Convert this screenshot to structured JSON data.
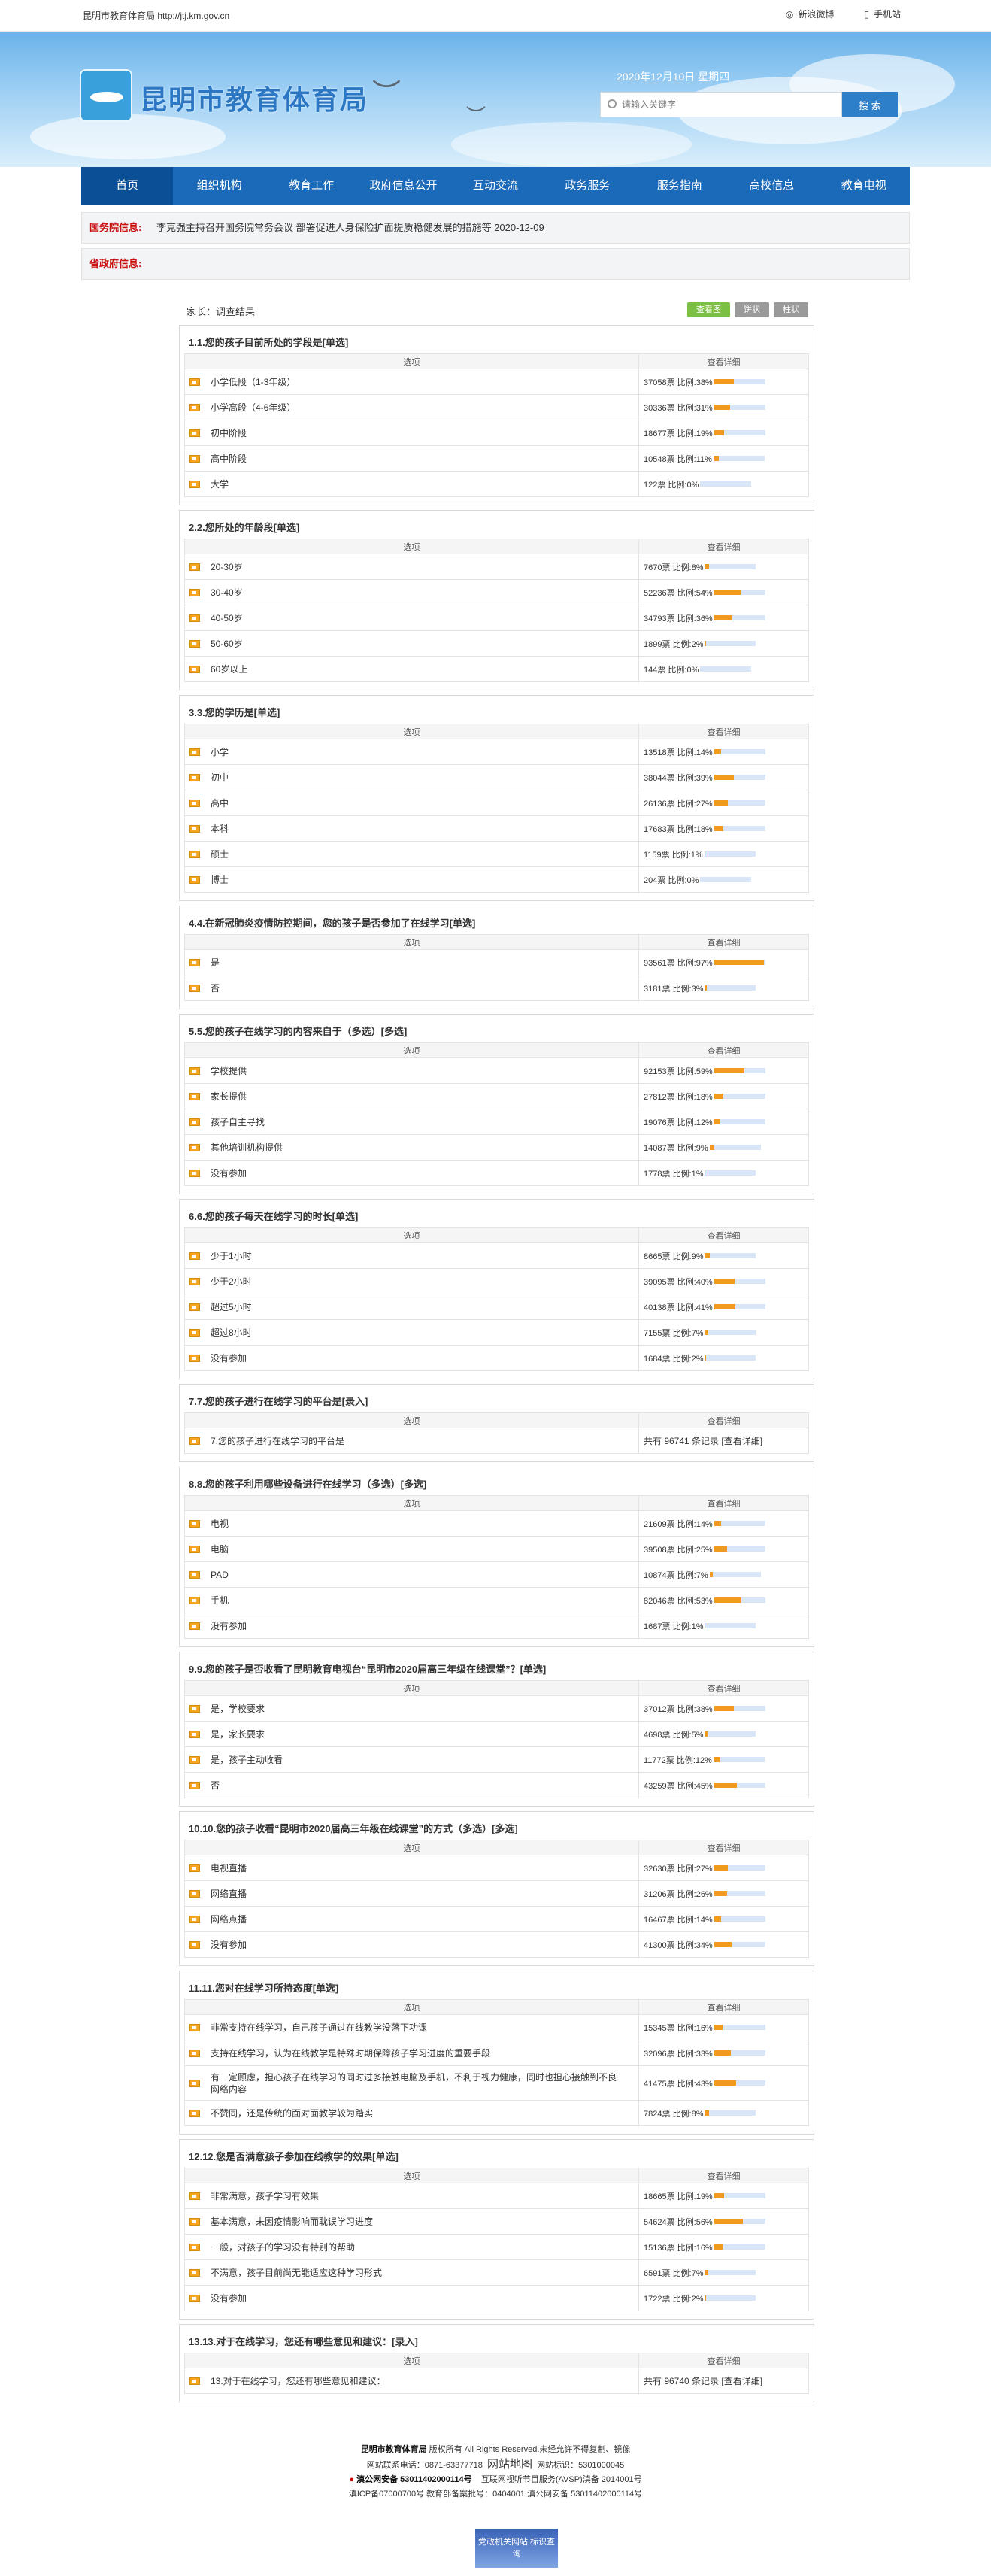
{
  "header": {
    "site_name": "昆明市教育体育局",
    "site_url": "http://jtj.km.gov.cn",
    "weibo": "新浪微博",
    "mobile": "手机站",
    "logo_text": "昆明市教育体育局",
    "date": "2020年12月10日 星期四",
    "search_placeholder": "请输入关键字",
    "search_button": "搜 索"
  },
  "nav": [
    "首页",
    "组织机构",
    "教育工作",
    "政府信息公开",
    "互动交流",
    "政务服务",
    "服务指南",
    "高校信息",
    "教育电视"
  ],
  "info": {
    "gov_label": "国务院信息:",
    "gov_text": "李克强主持召开国务院常务会议 部署促进人身保险扩面提质稳健发展的措施等 2020-12-09",
    "prov_label": "省政府信息:"
  },
  "crumb": "家长：调查结果",
  "buttons": [
    "查看图",
    "饼状",
    "柱状"
  ],
  "columns": {
    "option": "选项",
    "detail": "查看详细"
  },
  "questions": [
    {
      "title": "1.1.您的孩子目前所处的学段是[单选]",
      "options": [
        [
          "小学低段（1-3年级）",
          "37058票 比例:38%"
        ],
        [
          "小学高段（4-6年级）",
          "30336票 比例:31%"
        ],
        [
          "初中阶段",
          "18677票 比例:19%"
        ],
        [
          "高中阶段",
          "10548票 比例:11%"
        ],
        [
          "大学",
          "122票 比例:0%"
        ]
      ]
    },
    {
      "title": "2.2.您所处的年龄段[单选]",
      "options": [
        [
          "20-30岁",
          "7670票 比例:8%"
        ],
        [
          "30-40岁",
          "52236票 比例:54%"
        ],
        [
          "40-50岁",
          "34793票 比例:36%"
        ],
        [
          "50-60岁",
          "1899票 比例:2%"
        ],
        [
          "60岁以上",
          "144票 比例:0%"
        ]
      ]
    },
    {
      "title": "3.3.您的学历是[单选]",
      "options": [
        [
          "小学",
          "13518票 比例:14%"
        ],
        [
          "初中",
          "38044票 比例:39%"
        ],
        [
          "高中",
          "26136票 比例:27%"
        ],
        [
          "本科",
          "17683票 比例:18%"
        ],
        [
          "硕士",
          "1159票 比例:1%"
        ],
        [
          "博士",
          "204票 比例:0%"
        ]
      ]
    },
    {
      "title": "4.4.在新冠肺炎疫情防控期间，您的孩子是否参加了在线学习[单选]",
      "options": [
        [
          "是",
          "93561票 比例:97%"
        ],
        [
          "否",
          "3181票 比例:3%"
        ]
      ]
    },
    {
      "title": "5.5.您的孩子在线学习的内容来自于（多选）[多选]",
      "options": [
        [
          "学校提供",
          "92153票 比例:59%"
        ],
        [
          "家长提供",
          "27812票 比例:18%"
        ],
        [
          "孩子自主寻找",
          "19076票 比例:12%"
        ],
        [
          "其他培训机构提供",
          "14087票 比例:9%"
        ],
        [
          "没有参加",
          "1778票 比例:1%"
        ]
      ]
    },
    {
      "title": "6.6.您的孩子每天在线学习的时长[单选]",
      "options": [
        [
          "少于1小时",
          "8665票 比例:9%"
        ],
        [
          "少于2小时",
          "39095票 比例:40%"
        ],
        [
          "超过5小时",
          "40138票 比例:41%"
        ],
        [
          "超过8小时",
          "7155票 比例:7%"
        ],
        [
          "没有参加",
          "1684票 比例:2%"
        ]
      ]
    },
    {
      "title": "7.7.您的孩子进行在线学习的平台是[录入]",
      "input": true,
      "options": [
        [
          "7.您的孩子进行在线学习的平台是",
          "共有 96741 条记录 [查看详细]"
        ]
      ]
    },
    {
      "title": "8.8.您的孩子利用哪些设备进行在线学习（多选）[多选]",
      "options": [
        [
          "电视",
          "21609票 比例:14%"
        ],
        [
          "电脑",
          "39508票 比例:25%"
        ],
        [
          "PAD",
          "10874票 比例:7%"
        ],
        [
          "手机",
          "82046票 比例:53%"
        ],
        [
          "没有参加",
          "1687票 比例:1%"
        ]
      ]
    },
    {
      "title": "9.9.您的孩子是否收看了昆明教育电视台“昆明市2020届高三年级在线课堂”？[单选]",
      "options": [
        [
          "是，学校要求",
          "37012票 比例:38%"
        ],
        [
          "是，家长要求",
          "4698票 比例:5%"
        ],
        [
          "是，孩子主动收看",
          "11772票 比例:12%"
        ],
        [
          "否",
          "43259票 比例:45%"
        ]
      ]
    },
    {
      "title": "10.10.您的孩子收看“昆明市2020届高三年级在线课堂”的方式（多选）[多选]",
      "options": [
        [
          "电视直播",
          "32630票 比例:27%"
        ],
        [
          "网络直播",
          "31206票 比例:26%"
        ],
        [
          "网络点播",
          "16467票 比例:14%"
        ],
        [
          "没有参加",
          "41300票 比例:34%"
        ]
      ]
    },
    {
      "title": "11.11.您对在线学习所持态度[单选]",
      "options": [
        [
          "非常支持在线学习，自己孩子通过在线教学没落下功课",
          "15345票 比例:16%"
        ],
        [
          "支持在线学习，认为在线教学是特殊时期保障孩子学习进度的重要手段",
          "32096票 比例:33%"
        ],
        [
          "有一定顾虑，担心孩子在线学习的同时过多接触电脑及手机，不利于视力健康，同时也担心接触到不良网络内容",
          "41475票 比例:43%"
        ],
        [
          "不赞同，还是传统的面对面教学较为踏实",
          "7824票 比例:8%"
        ]
      ]
    },
    {
      "title": "12.12.您是否满意孩子参加在线教学的效果[单选]",
      "options": [
        [
          "非常满意，孩子学习有效果",
          "18665票 比例:19%"
        ],
        [
          "基本满意，未因疫情影响而耽误学习进度",
          "54624票 比例:56%"
        ],
        [
          "一般，对孩子的学习没有特别的帮助",
          "15136票 比例:16%"
        ],
        [
          "不满意，孩子目前尚无能适应这种学习形式",
          "6591票 比例:7%"
        ],
        [
          "没有参加",
          "1722票 比例:2%"
        ]
      ]
    },
    {
      "title": "13.13.对于在线学习，您还有哪些意见和建议：[录入]",
      "input": true,
      "options": [
        [
          "13.对于在线学习，您还有哪些意见和建议：",
          "共有 96740 条记录 [查看详细]"
        ]
      ]
    }
  ],
  "footer": {
    "line1a": "昆明市教育体育局",
    "line1b": " 版权所有 All Rights Reserved.未经允许不得复制、镜像",
    "line2a": "网站联系电话：0871-63377718",
    "line2b": "网站地图",
    "line2c": "网站标识：5301000045",
    "line3a": "滇公网安备 53011402000114号",
    "line3b": "互联网视听节目服务(AVSP)滇备 2014001号",
    "line4": "滇ICP备07000700号 教育部备案批号：0404001 滇公网安备 53011402000114号",
    "badge": "党政机关网站 标识查询"
  }
}
